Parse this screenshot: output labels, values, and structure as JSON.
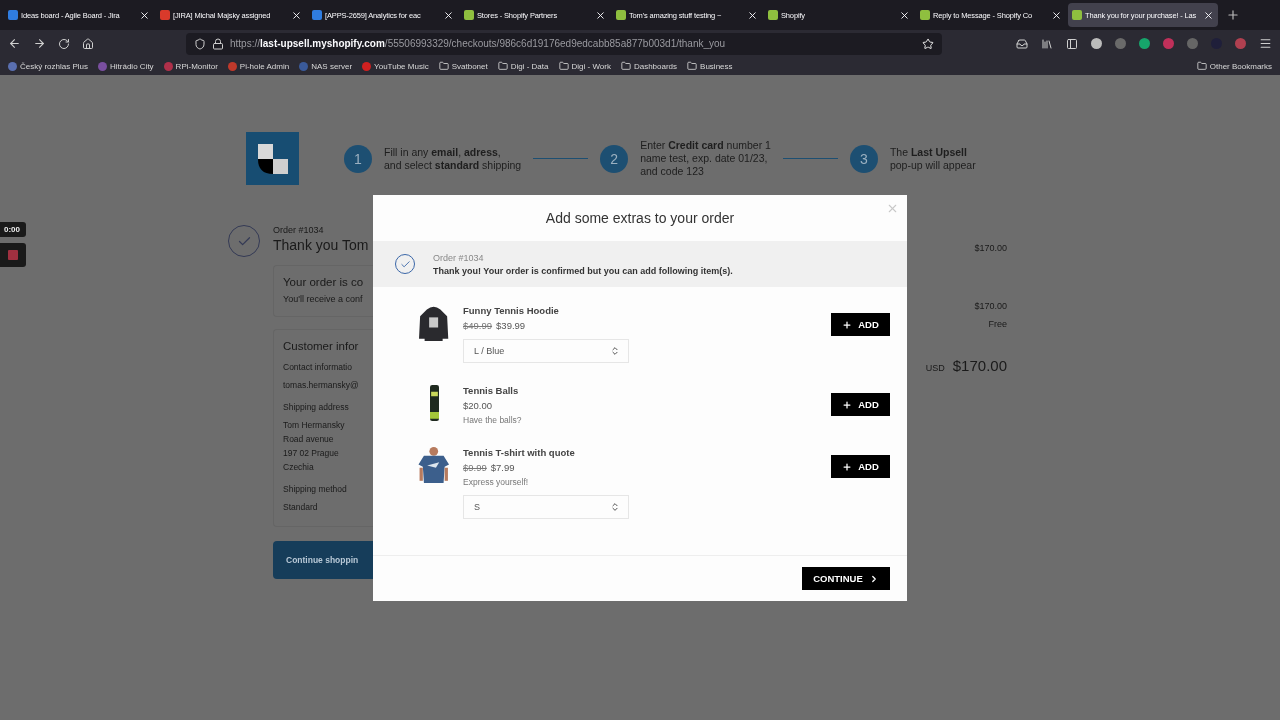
{
  "browser": {
    "tabs": [
      {
        "title": "Ideas board - Agile Board - Jira",
        "selected": false,
        "color": "#2f7de1"
      },
      {
        "title": "[JIRA] Michal Majsky assigned",
        "selected": false,
        "color": "#d93a2b"
      },
      {
        "title": "[APPS-2659] Analytics for eac",
        "selected": false,
        "color": "#2f7de1"
      },
      {
        "title": "Stores - Shopify Partners",
        "selected": false,
        "color": "#8fbf3f"
      },
      {
        "title": "Tom's amazing stuff testing ~",
        "selected": false,
        "color": "#8fbf3f"
      },
      {
        "title": "Shopify",
        "selected": false,
        "color": "#8fbf3f"
      },
      {
        "title": "Reply to Message - Shopify Co",
        "selected": false,
        "color": "#8fbf3f"
      },
      {
        "title": "Thank you for your purchase! - Las",
        "selected": true,
        "color": "#8fbf3f"
      }
    ],
    "address": {
      "prefix": "https://",
      "host": "last-upsell.myshopify.com",
      "path": "/55506993329/checkouts/986c6d19176ed9edcabb85a877b003d1/thank_you"
    },
    "bookmarks": [
      {
        "label": "Český rozhlas Plus",
        "kind": "site",
        "color": "#5a6fb0"
      },
      {
        "label": "Hitrádio City",
        "kind": "site",
        "color": "#7a4fa0"
      },
      {
        "label": "RPi-Monitor",
        "kind": "site",
        "color": "#b0304a"
      },
      {
        "label": "Pi-hole Admin",
        "kind": "site",
        "color": "#c0392b"
      },
      {
        "label": "NAS server",
        "kind": "site",
        "color": "#3a5a9a"
      },
      {
        "label": "YouTube Music",
        "kind": "site",
        "color": "#d02020"
      },
      {
        "label": "Svatbonet",
        "kind": "folder"
      },
      {
        "label": "Digi - Data",
        "kind": "folder"
      },
      {
        "label": "Digi - Work",
        "kind": "folder"
      },
      {
        "label": "Dashboards",
        "kind": "folder"
      },
      {
        "label": "Business",
        "kind": "folder"
      }
    ],
    "other_bookmarks": "Other Bookmarks"
  },
  "recorder": {
    "time": "0:00"
  },
  "page": {
    "steps": [
      {
        "number": "1",
        "lines": [
          "Fill in any **email**, **adress**,",
          "and select **standard** shipping"
        ]
      },
      {
        "number": "2",
        "lines": [
          "Enter **Credit card** number 1",
          "name test, exp. date 01/23,",
          "and code 123"
        ]
      },
      {
        "number": "3",
        "lines": [
          "The **Last Upsell**",
          "pop-up will appear"
        ]
      }
    ],
    "order_number": "Order #1034",
    "heading": "Thank you Tom",
    "status_card": {
      "title": "Your order is co",
      "text": "You'll receive a conf"
    },
    "customer_card": {
      "title": "Customer infor",
      "sections": [
        {
          "label": "Contact informatio",
          "lines": [
            "tomas.hermansky@"
          ]
        },
        {
          "label": "Shipping address",
          "lines": [
            "Tom Hermansky",
            "Road avenue",
            "197 02 Prague",
            "Czechia"
          ]
        },
        {
          "label": "Shipping method",
          "lines": [
            "Standard"
          ]
        }
      ]
    },
    "continue_button": "Continue shoppin",
    "summary": {
      "rows": [
        "$170.00",
        "$170.00",
        "Free"
      ],
      "currency": "USD",
      "total": "$170.00"
    }
  },
  "modal": {
    "title": "Add some extras to your order",
    "banner": {
      "order": "Order #1034",
      "message": "Thank you! Your order is confirmed but you can add following item(s)."
    },
    "items": [
      {
        "name": "Funny Tennis Hoodie",
        "old_price": "$49.99",
        "price": "$39.99",
        "variant": "L / Blue",
        "add": "ADD",
        "kind": "hoodie"
      },
      {
        "name": "Tennis Balls",
        "price": "$20.00",
        "description": "Have the balls?",
        "add": "ADD",
        "kind": "balls"
      },
      {
        "name": "Tennis T-shirt with quote",
        "old_price": "$9.99",
        "price": "$7.99",
        "description": "Express yourself!",
        "variant": "S",
        "add": "ADD",
        "kind": "tshirt"
      }
    ],
    "continue": "CONTINUE"
  }
}
